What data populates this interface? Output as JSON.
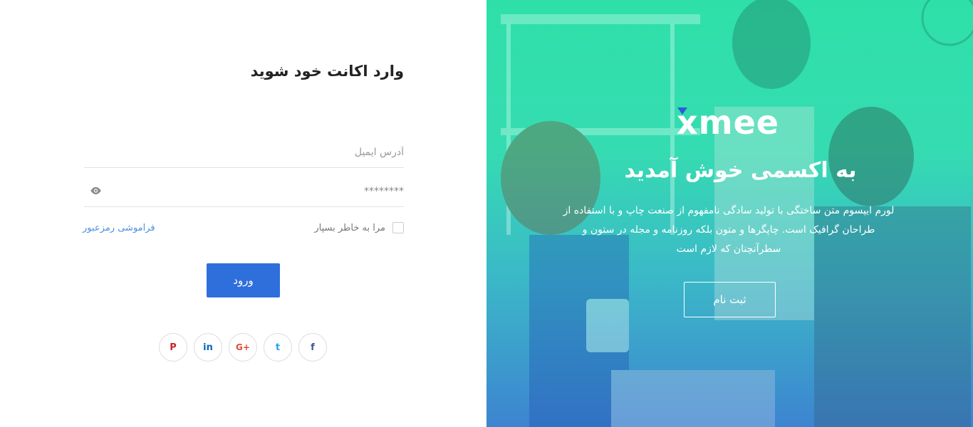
{
  "login": {
    "title": "وارد اکانت خود شوید",
    "email_placeholder": "آدرس ایمیل",
    "password_value": "********",
    "remember_label": "مرا به خاطر بسپار",
    "forgot_label": "فراموشی رمزعبور",
    "submit_label": "ورود"
  },
  "socials": [
    {
      "icon": "pinterest-icon",
      "glyph": "P"
    },
    {
      "icon": "linkedin-icon",
      "glyph": "in"
    },
    {
      "icon": "google-plus-icon",
      "glyph": "G+"
    },
    {
      "icon": "twitter-icon",
      "glyph": "t"
    },
    {
      "icon": "facebook-icon",
      "glyph": "f"
    }
  ],
  "hero": {
    "logo": "xmee",
    "welcome": "به اکسمی خوش آمدید",
    "description": "لورم ایپسوم متن ساختگی با تولید سادگی نامفهوم از صنعت چاپ و با استفاده از طراحان گرافیک است. چاپگرها و متون بلکه روزنامه و مجله در ستون و سطرآنچنان که لازم است",
    "signup_label": "ثبت نام"
  },
  "colors": {
    "primary": "#2f6fdb",
    "link": "#4a8fe0",
    "gradient_top": "#2ee0a8",
    "gradient_bottom": "#3d84d0"
  }
}
